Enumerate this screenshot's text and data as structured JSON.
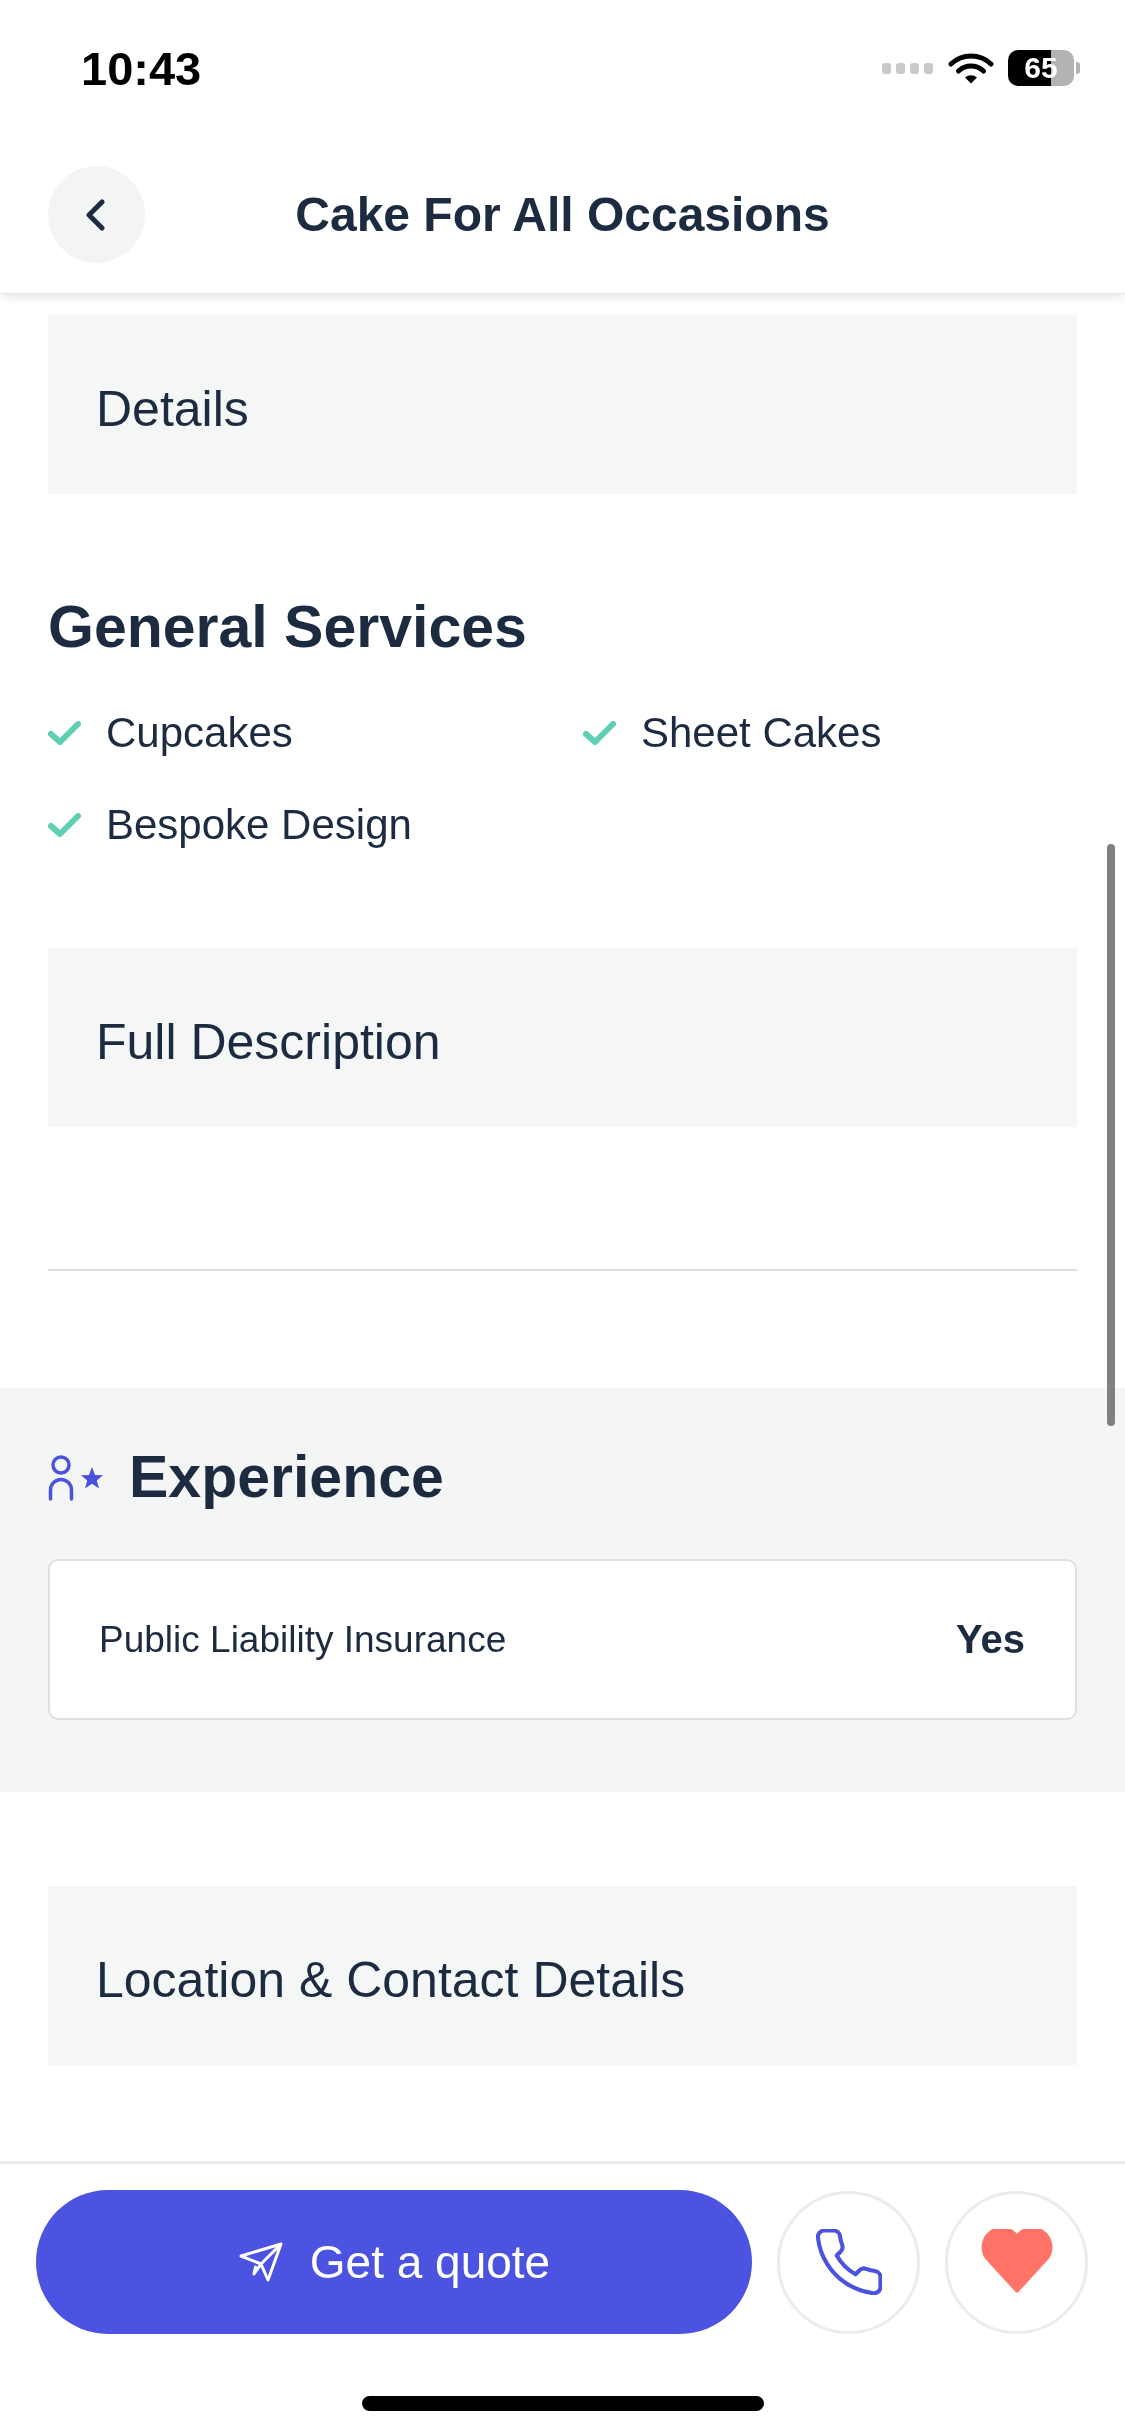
{
  "status_bar": {
    "time": "10:43",
    "battery": "65"
  },
  "header": {
    "title": "Cake For All Occasions"
  },
  "details_panel": {
    "label": "Details"
  },
  "general_services": {
    "title": "General Services",
    "items": [
      "Cupcakes",
      "Sheet Cakes",
      "Bespoke Design"
    ]
  },
  "full_description_panel": {
    "label": "Full Description"
  },
  "experience": {
    "title": "Experience",
    "rows": [
      {
        "label": "Public Liability Insurance",
        "value": "Yes"
      }
    ]
  },
  "location_panel": {
    "label": "Location & Contact Details"
  },
  "actions": {
    "quote_label": "Get a quote",
    "favorited": true
  }
}
